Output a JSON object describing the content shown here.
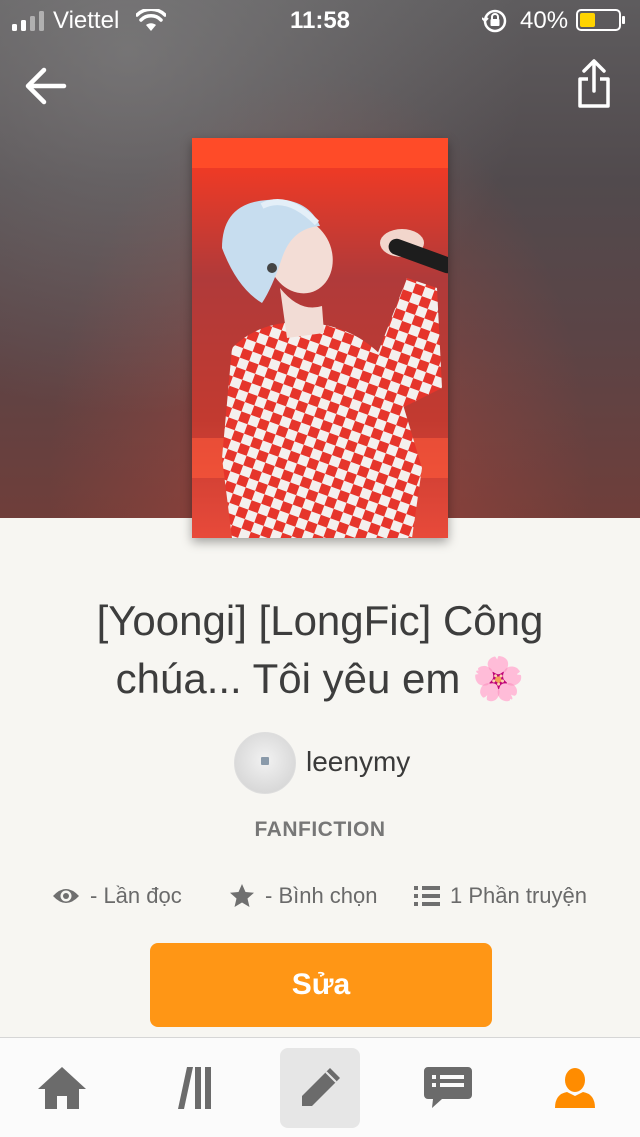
{
  "status_bar": {
    "carrier": "Viettel",
    "time": "11:58",
    "battery": "40%",
    "battery_level": 0.4
  },
  "header": {
    "back_icon": "arrow-left-icon",
    "share_icon": "share-icon"
  },
  "story": {
    "title": "[Yoongi] [LongFic] Công chúa... Tôi yêu em 🌸",
    "author": "leenymy",
    "category": "FANFICTION",
    "stats": {
      "reads": "- Lần đọc",
      "votes": "- Bình chọn",
      "parts": "1 Phần truyện"
    },
    "edit_label": "Sửa"
  },
  "tabbar": {
    "items": [
      "home-icon",
      "library-icon",
      "write-icon",
      "messages-icon",
      "profile-icon"
    ],
    "active": "profile-icon",
    "selected": "write-icon"
  },
  "colors": {
    "accent": "#ff9615",
    "active_tab": "#ff8c00",
    "icon_gray": "#6b6b6b"
  }
}
